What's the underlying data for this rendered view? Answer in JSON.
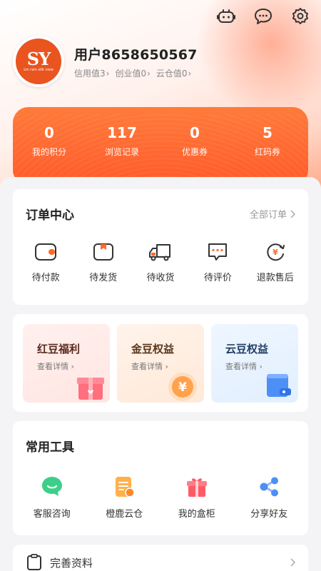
{
  "header": {
    "icons": [
      "robot-icon",
      "chat-icon",
      "gear-icon"
    ]
  },
  "user": {
    "avatar_mono": "SY",
    "avatar_sub": "Lin rain silk view",
    "name": "用户8658650567",
    "credit": "信用值3",
    "startup": "创业值0",
    "cloud_warehouse": "云仓值0"
  },
  "stats": [
    {
      "value": "0",
      "label": "我的积分"
    },
    {
      "value": "117",
      "label": "浏览记录"
    },
    {
      "value": "0",
      "label": "优惠券"
    },
    {
      "value": "5",
      "label": "红码券"
    }
  ],
  "orders": {
    "title": "订单中心",
    "all_label": "全部订单",
    "items": [
      {
        "icon": "wallet-icon",
        "label": "待付款"
      },
      {
        "icon": "package-icon",
        "label": "待发货"
      },
      {
        "icon": "truck-icon",
        "label": "待收货"
      },
      {
        "icon": "comment-icon",
        "label": "待评价"
      },
      {
        "icon": "refund-icon",
        "label": "退款售后"
      }
    ]
  },
  "benefits": [
    {
      "title": "红豆福利",
      "link": "查看详情",
      "icon": "gift-icon"
    },
    {
      "title": "金豆权益",
      "link": "查看详情",
      "icon": "coin-icon"
    },
    {
      "title": "云豆权益",
      "link": "查看详情",
      "icon": "card-icon"
    }
  ],
  "tools": {
    "title": "常用工具",
    "items": [
      {
        "icon": "service-chat-icon",
        "label": "客服咨询"
      },
      {
        "icon": "document-icon",
        "label": "橙鹿云仓"
      },
      {
        "icon": "gift-box-icon",
        "label": "我的盒柜"
      },
      {
        "icon": "share-icon",
        "label": "分享好友"
      }
    ]
  },
  "complete_profile": {
    "label": "完善资料"
  },
  "colors": {
    "accent": "#ff5a2a",
    "accent_light": "#ff7b3a",
    "avatar_bg": "#e9541f"
  }
}
